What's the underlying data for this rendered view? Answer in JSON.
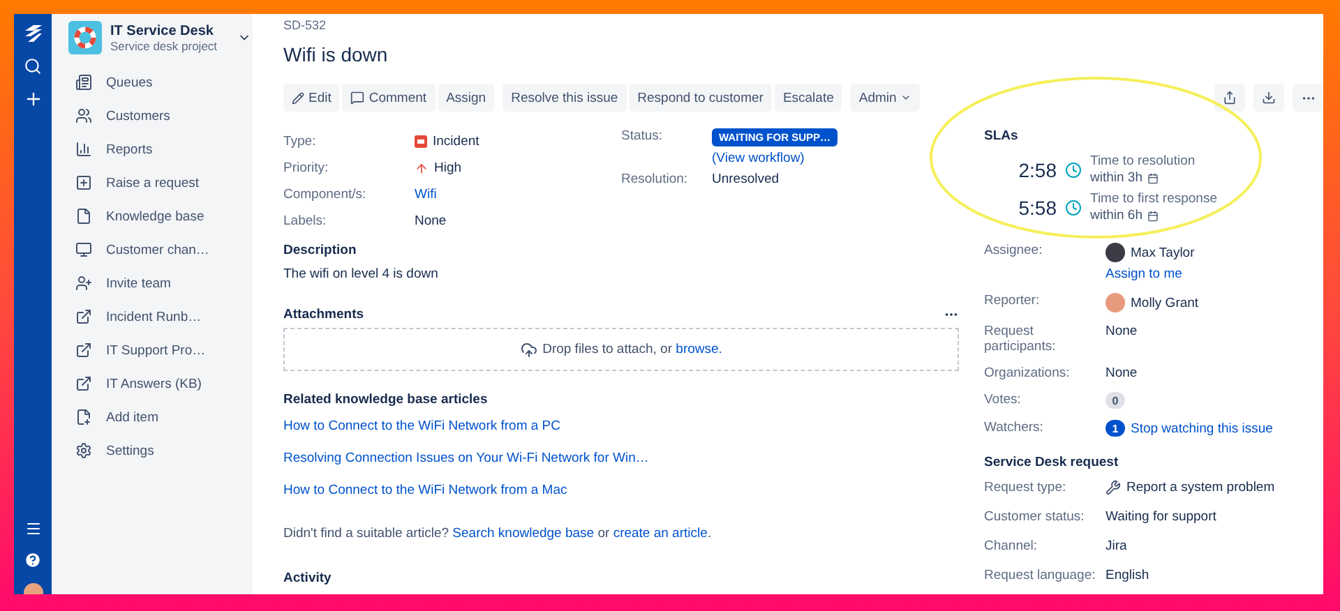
{
  "project": {
    "name": "IT Service Desk",
    "subtitle": "Service desk project"
  },
  "sidebar": {
    "items": [
      {
        "label": "Queues",
        "kind": "queues"
      },
      {
        "label": "Customers",
        "kind": "customers"
      },
      {
        "label": "Reports",
        "kind": "reports"
      },
      {
        "label": "Raise a request",
        "kind": "raise"
      },
      {
        "label": "Knowledge base",
        "kind": "knowledge"
      },
      {
        "label": "Customer chan…",
        "kind": "channel"
      },
      {
        "label": "Invite team",
        "kind": "invite"
      },
      {
        "label": "Incident Runb…",
        "kind": "external"
      },
      {
        "label": "IT Support Pro…",
        "kind": "external"
      },
      {
        "label": "IT Answers (KB)",
        "kind": "external"
      },
      {
        "label": "Add item",
        "kind": "add"
      },
      {
        "label": "Settings",
        "kind": "settings"
      }
    ]
  },
  "issue": {
    "key": "SD-532",
    "title": "Wifi is down"
  },
  "toolbar": {
    "groups": [
      [
        {
          "label": "Edit",
          "kind": "edit"
        },
        {
          "label": "Comment",
          "kind": "comment"
        },
        {
          "label": "Assign",
          "kind": "plain"
        }
      ],
      [
        {
          "label": "Resolve this issue",
          "kind": "plain"
        },
        {
          "label": "Respond to customer",
          "kind": "plain"
        },
        {
          "label": "Escalate",
          "kind": "plain"
        }
      ],
      [
        {
          "label": "Admin",
          "kind": "menu"
        }
      ]
    ]
  },
  "details": [
    {
      "label": "Type:",
      "value": "Incident",
      "kind": "type"
    },
    {
      "label": "Priority:",
      "value": "High",
      "kind": "priority"
    },
    {
      "label": "Component/s:",
      "value": "Wifi",
      "kind": "link"
    },
    {
      "label": "Labels:",
      "value": "None",
      "kind": "text"
    }
  ],
  "status": {
    "label": "Status:",
    "badge": "WAITING FOR SUPP…",
    "link": "(View workflow)"
  },
  "resolution": {
    "label": "Resolution:",
    "value": "Unresolved"
  },
  "description": {
    "title": "Description",
    "text": "The wifi on level 4 is down"
  },
  "attachments": {
    "title": "Attachments",
    "drop_text": "Drop files to attach, or",
    "link": "browse."
  },
  "related": {
    "title": "Related knowledge base articles",
    "links": [
      "How to Connect to the WiFi Network from a PC",
      "Resolving Connection Issues on Your Wi-Fi Network for Win…",
      "How to Connect to the WiFi Network from a Mac"
    ],
    "footer": {
      "question": "Didn't find a suitable article?",
      "search_link": "Search knowledge base",
      "joiner": "or",
      "create_link": "create an article",
      "end": "."
    }
  },
  "activity": {
    "title": "Activity"
  },
  "slas": {
    "title": "SLAs",
    "items": [
      {
        "time": "2:58",
        "name": "Time to resolution",
        "target": "within 3h"
      },
      {
        "time": "5:58",
        "name": "Time to first response",
        "target": "within 6h"
      }
    ]
  },
  "people": [
    {
      "label": "Assignee:",
      "kind": "person",
      "value": "Max Taylor",
      "action": "Assign to me"
    },
    {
      "label": "Reporter:",
      "kind": "person",
      "value": "Molly Grant"
    },
    {
      "label": "Request participants:",
      "kind": "text",
      "value": "None"
    },
    {
      "label": "Organizations:",
      "kind": "text",
      "value": "None"
    },
    {
      "label": "Votes:",
      "kind": "count",
      "count": "0"
    },
    {
      "label": "Watchers:",
      "kind": "watch",
      "count": "1",
      "action": "Stop watching this issue"
    }
  ],
  "service_request": {
    "title": "Service Desk request",
    "rows": [
      {
        "label": "Request type:",
        "kind": "request",
        "value": "Report a system problem"
      },
      {
        "label": "Customer status:",
        "kind": "text",
        "value": "Waiting for support"
      },
      {
        "label": "Channel:",
        "kind": "text",
        "value": "Jira"
      },
      {
        "label": "Request language:",
        "kind": "text",
        "value": "English"
      }
    ]
  }
}
